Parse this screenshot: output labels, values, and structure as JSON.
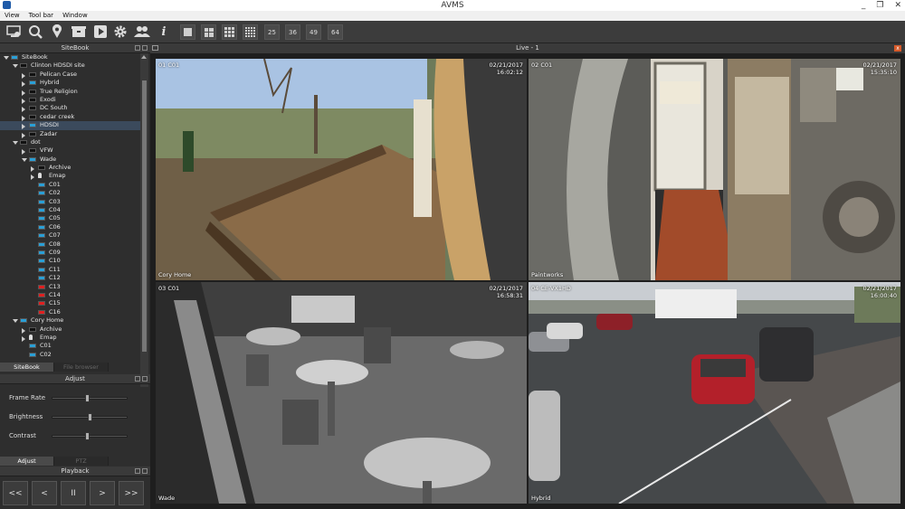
{
  "window": {
    "title": "AVMS",
    "controls": [
      "_",
      "❐",
      "✕"
    ]
  },
  "menu": [
    "View",
    "Tool bar",
    "Window"
  ],
  "toolbar": {
    "icons": [
      "monitor-icon",
      "zoom-icon",
      "map-pin-icon",
      "archive-icon",
      "playback-icon",
      "settings-icon",
      "users-icon",
      "info-icon"
    ],
    "layouts": [
      "1",
      "4",
      "9",
      "16",
      "25",
      "36",
      "49",
      "64"
    ]
  },
  "sitebook": {
    "title": "SiteBook",
    "items": [
      {
        "label": "SiteBook",
        "level": 0,
        "arrow": "down",
        "icon": "#2a9fd6"
      },
      {
        "label": "Clinton HDSDI site",
        "level": 1,
        "arrow": "down",
        "icon": "#111111"
      },
      {
        "label": "Pelican Case",
        "level": 2,
        "arrow": "right",
        "icon": "#111111"
      },
      {
        "label": "Hybrid",
        "level": 2,
        "arrow": "right",
        "icon": "#2a9fd6"
      },
      {
        "label": "True Religion",
        "level": 2,
        "arrow": "right",
        "icon": "#111111"
      },
      {
        "label": "Exodi",
        "level": 2,
        "arrow": "right",
        "icon": "#111111"
      },
      {
        "label": "DC South",
        "level": 2,
        "arrow": "right",
        "icon": "#111111"
      },
      {
        "label": "cedar creek",
        "level": 2,
        "arrow": "right",
        "icon": "#111111"
      },
      {
        "label": "HDSDI",
        "level": 2,
        "arrow": "right",
        "icon": "#2a9fd6",
        "selected": true
      },
      {
        "label": "Zadar",
        "level": 2,
        "arrow": "right",
        "icon": "#111111"
      },
      {
        "label": "dot",
        "level": 1,
        "arrow": "down",
        "icon": "#111111"
      },
      {
        "label": "VFW",
        "level": 2,
        "arrow": "right",
        "icon": "#111111"
      },
      {
        "label": "Wade",
        "level": 2,
        "arrow": "down",
        "icon": "#2a9fd6"
      },
      {
        "label": "Archive",
        "level": 3,
        "arrow": "right",
        "icon": "#111111"
      },
      {
        "label": "Emap",
        "level": 3,
        "arrow": "right",
        "icon": "pin"
      },
      {
        "label": "C01",
        "level": 3,
        "icon": "#2a9fd6"
      },
      {
        "label": "C02",
        "level": 3,
        "icon": "#2a9fd6"
      },
      {
        "label": "C03",
        "level": 3,
        "icon": "#2a9fd6"
      },
      {
        "label": "C04",
        "level": 3,
        "icon": "#2a9fd6"
      },
      {
        "label": "C05",
        "level": 3,
        "icon": "#2a9fd6"
      },
      {
        "label": "C06",
        "level": 3,
        "icon": "#2a9fd6"
      },
      {
        "label": "C07",
        "level": 3,
        "icon": "#2a9fd6"
      },
      {
        "label": "C08",
        "level": 3,
        "icon": "#2a9fd6"
      },
      {
        "label": "C09",
        "level": 3,
        "icon": "#2a9fd6"
      },
      {
        "label": "C10",
        "level": 3,
        "icon": "#2a9fd6"
      },
      {
        "label": "C11",
        "level": 3,
        "icon": "#2a9fd6"
      },
      {
        "label": "C12",
        "level": 3,
        "icon": "#2a9fd6"
      },
      {
        "label": "C13",
        "level": 3,
        "icon": "#e02020"
      },
      {
        "label": "C14",
        "level": 3,
        "icon": "#e02020"
      },
      {
        "label": "C15",
        "level": 3,
        "icon": "#e02020"
      },
      {
        "label": "C16",
        "level": 3,
        "icon": "#e02020"
      },
      {
        "label": "Cory Home",
        "level": 1,
        "arrow": "down",
        "icon": "#2a9fd6"
      },
      {
        "label": "Archive",
        "level": 2,
        "arrow": "right",
        "icon": "#111111"
      },
      {
        "label": "Emap",
        "level": 2,
        "arrow": "right",
        "icon": "pin"
      },
      {
        "label": "C01",
        "level": 2,
        "icon": "#2a9fd6"
      },
      {
        "label": "C02",
        "level": 2,
        "icon": "#2a9fd6"
      }
    ],
    "tabs": [
      "SiteBook",
      "File browser"
    ]
  },
  "adjust": {
    "title": "Adjust",
    "rows": [
      {
        "label": "Frame Rate",
        "level": 0.47
      },
      {
        "label": "Brightness",
        "level": 0.5
      },
      {
        "label": "Contrast",
        "level": 0.47
      }
    ],
    "tabs": [
      "Adjust",
      "PTZ"
    ]
  },
  "playback": {
    "title": "Playback",
    "buttons": [
      "<<",
      "<",
      "II",
      ">",
      ">>"
    ]
  },
  "live": {
    "title": "Live - 1",
    "tiles": [
      {
        "cam": "01 C01",
        "date": "02/21/2017",
        "time": "16:02:12",
        "name": "Cory Home",
        "active": true
      },
      {
        "cam": "02 C01",
        "date": "02/21/2017",
        "time": "15:35:10",
        "name": "Paintworks",
        "active": false
      },
      {
        "cam": "03 C01",
        "date": "02/21/2017",
        "time": "16:58:31",
        "name": "Wade",
        "active": false
      },
      {
        "cam": "04 CE-VX1HD",
        "date": "02/21/2017",
        "time": "16:00:40",
        "name": "Hybrid",
        "active": false
      }
    ]
  }
}
